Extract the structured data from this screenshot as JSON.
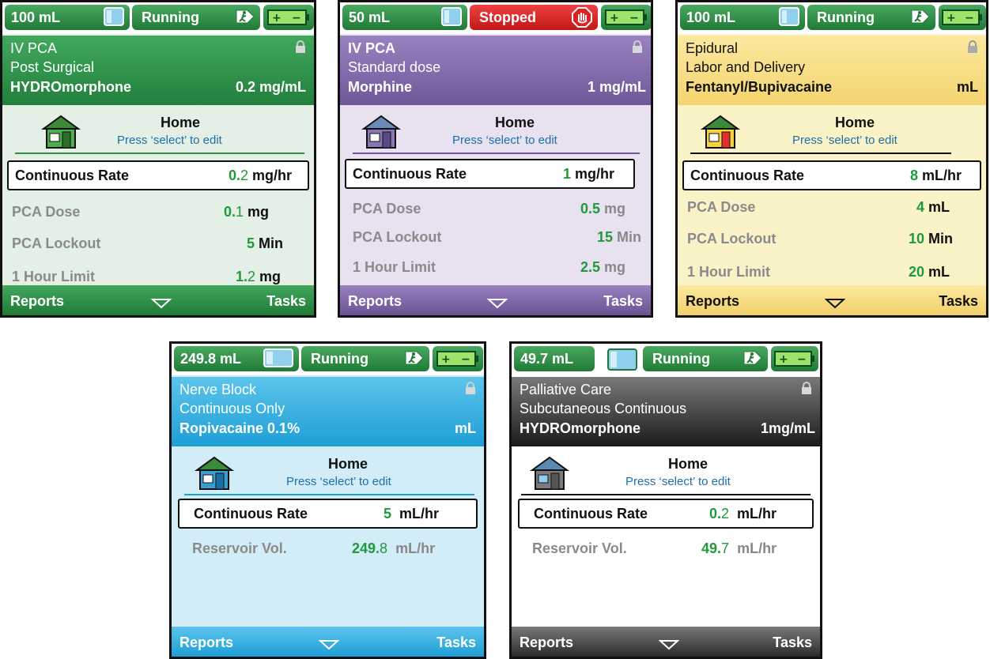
{
  "screens": [
    {
      "volume": "100 mL",
      "status": "Running",
      "header": {
        "line1": "IV PCA",
        "line2": "Post Surgical",
        "drug": "HYDROmorphone",
        "concentration": "0.2 mg/mL"
      },
      "home": {
        "title": "Home",
        "subtitle": "Press ‘select’ to edit"
      },
      "rows": [
        {
          "label": "Continuous Rate",
          "value_bold": "0.",
          "value_rest": "2",
          "unit": "mg/hr"
        },
        {
          "label": "PCA Dose",
          "value_bold": "0.",
          "value_rest": "1",
          "unit": "mg"
        },
        {
          "label": "PCA Lockout",
          "value_bold": "5",
          "value_rest": "",
          "unit": "Min"
        },
        {
          "label": "1 Hour Limit",
          "value_bold": "1.",
          "value_rest": "2",
          "unit": "mg"
        }
      ],
      "footer": {
        "left": "Reports",
        "right": "Tasks"
      },
      "color": "#2e8f45"
    },
    {
      "volume": "50 mL",
      "status": "Stopped",
      "header": {
        "line1": "IV PCA",
        "line2": "Standard dose",
        "drug": "Morphine",
        "concentration": "1 mg/mL"
      },
      "home": {
        "title": "Home",
        "subtitle": "Press ‘select’ to edit"
      },
      "rows": [
        {
          "label": "Continuous Rate",
          "value_bold": "1",
          "value_rest": "",
          "unit": "mg/hr"
        },
        {
          "label": "PCA Dose",
          "value_bold": "0.5",
          "value_rest": "",
          "unit": "mg"
        },
        {
          "label": "PCA Lockout",
          "value_bold": "15",
          "value_rest": "",
          "unit": "Min"
        },
        {
          "label": "1 Hour Limit",
          "value_bold": "2.5",
          "value_rest": "",
          "unit": "mg"
        }
      ],
      "footer": {
        "left": "Reports",
        "right": "Tasks"
      },
      "color": "#7a5fa0"
    },
    {
      "volume": "100 mL",
      "status": "Running",
      "header": {
        "line1": "Epidural",
        "line2": "Labor and Delivery",
        "drug": "Fentanyl/Bupivacaine",
        "concentration": "mL"
      },
      "home": {
        "title": "Home",
        "subtitle": "Press ‘select’ to edit"
      },
      "rows": [
        {
          "label": "Continuous Rate",
          "value_bold": "8",
          "value_rest": "",
          "unit": "mL/hr"
        },
        {
          "label": "PCA Dose",
          "value_bold": "4",
          "value_rest": "",
          "unit": "mL"
        },
        {
          "label": "PCA Lockout",
          "value_bold": "10",
          "value_rest": "",
          "unit": "Min"
        },
        {
          "label": "1 Hour Limit",
          "value_bold": "20",
          "value_rest": "",
          "unit": "mL"
        }
      ],
      "footer": {
        "left": "Reports",
        "right": "Tasks"
      },
      "color": "#f5dd7a"
    },
    {
      "volume": "249.8 mL",
      "status": "Running",
      "header": {
        "line1": "Nerve Block",
        "line2": "Continuous Only",
        "drug": "Ropivacaine 0.1%",
        "concentration": "mL"
      },
      "home": {
        "title": "Home",
        "subtitle": "Press ‘select’ to edit"
      },
      "rows": [
        {
          "label": "Continuous Rate",
          "value_bold": "5",
          "value_rest": "",
          "unit": "mL/hr"
        },
        {
          "label": "Reservoir Vol.",
          "value_bold": "249.",
          "value_rest": "8",
          "unit": "mL/hr"
        }
      ],
      "footer": {
        "left": "Reports",
        "right": "Tasks"
      },
      "color": "#2aaee0"
    },
    {
      "volume": "49.7 mL",
      "status": "Running",
      "header": {
        "line1": "Palliative Care",
        "line2": "Subcutaneous Continuous",
        "drug": "HYDROmorphone",
        "concentration": "1mg/mL"
      },
      "home": {
        "title": "Home",
        "subtitle": "Press ‘select’ to edit"
      },
      "rows": [
        {
          "label": "Continuous Rate",
          "value_bold": "0.",
          "value_rest": "2",
          "unit": "mL/hr"
        },
        {
          "label": "Reservoir Vol.",
          "value_bold": "49.",
          "value_rest": "7",
          "unit": "mL/hr"
        }
      ],
      "footer": {
        "left": "Reports",
        "right": "Tasks"
      },
      "color": "#333333"
    }
  ]
}
